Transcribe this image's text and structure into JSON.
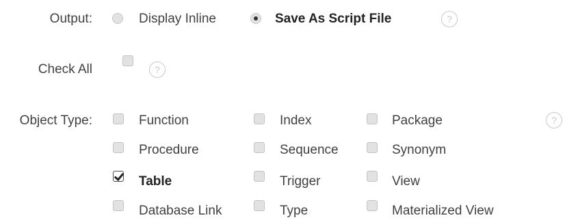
{
  "output": {
    "label": "Output:",
    "options": [
      {
        "label": "Display Inline",
        "selected": false
      },
      {
        "label": "Save As Script File",
        "selected": true
      }
    ],
    "help": "?"
  },
  "check_all": {
    "label": "Check All",
    "checked": false,
    "help": "?"
  },
  "object_type": {
    "label": "Object Type:",
    "help": "?",
    "items": [
      {
        "label": "Function",
        "checked": false
      },
      {
        "label": "Index",
        "checked": false
      },
      {
        "label": "Package",
        "checked": false
      },
      {
        "label": "Procedure",
        "checked": false
      },
      {
        "label": "Sequence",
        "checked": false
      },
      {
        "label": "Synonym",
        "checked": false
      },
      {
        "label": "Table",
        "checked": true
      },
      {
        "label": "Trigger",
        "checked": false
      },
      {
        "label": "View",
        "checked": false
      },
      {
        "label": "Database Link",
        "checked": false
      },
      {
        "label": "Type",
        "checked": false
      },
      {
        "label": "Materialized View",
        "checked": false
      }
    ]
  }
}
